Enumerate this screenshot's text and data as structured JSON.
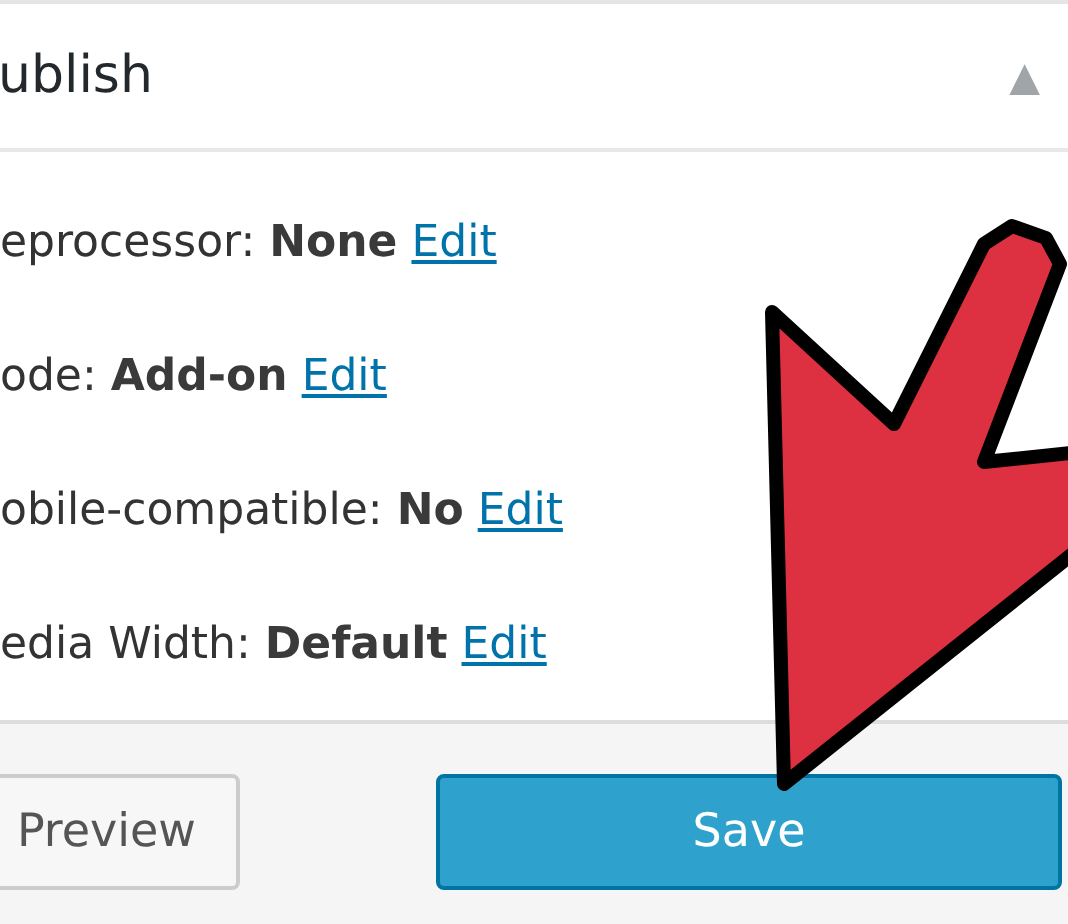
{
  "panel": {
    "title": "ublish",
    "collapse_icon": "▲"
  },
  "settings": [
    {
      "text": "eprocessor: **None**",
      "link": "Edit"
    },
    {
      "text": "ode: **Add-on**",
      "link": "Edit"
    },
    {
      "text": "obile-compatible: **No**",
      "link": "Edit"
    },
    {
      "text": "edia Width: **Default**",
      "link": "Edit"
    }
  ],
  "buttons": [
    {
      "label": "Preview",
      "kind": "secondary"
    },
    {
      "label": "Save",
      "kind": "primary"
    }
  ]
}
